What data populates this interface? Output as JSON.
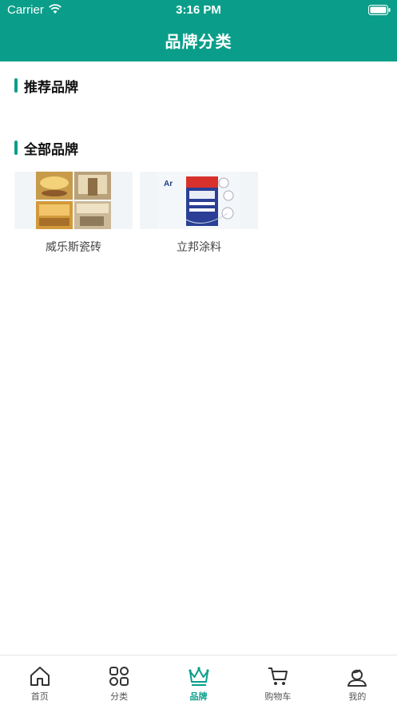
{
  "status_bar": {
    "carrier": "Carrier",
    "time": "3:16 PM"
  },
  "nav": {
    "title": "品牌分类"
  },
  "sections": {
    "recommended": {
      "title": "推荐品牌"
    },
    "all": {
      "title": "全部品牌"
    }
  },
  "brands": [
    {
      "name": "威乐斯瓷砖"
    },
    {
      "name": "立邦涂料"
    }
  ],
  "tabbar": {
    "items": [
      {
        "label": "首页",
        "icon": "home-icon"
      },
      {
        "label": "分类",
        "icon": "category-grid-icon"
      },
      {
        "label": "品牌",
        "icon": "crown-icon"
      },
      {
        "label": "购物车",
        "icon": "cart-icon"
      },
      {
        "label": "我的",
        "icon": "profile-icon"
      }
    ],
    "active_index": 2
  },
  "colors": {
    "accent": "#0a9e8a",
    "tab_inactive": "#555555"
  }
}
